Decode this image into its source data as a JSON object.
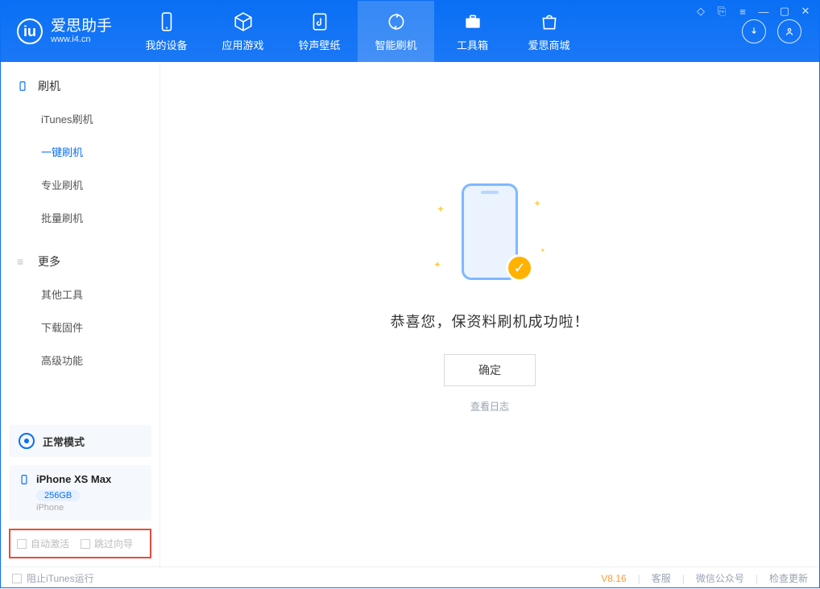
{
  "app": {
    "nameCN": "爱思助手",
    "nameEN": "www.i4.cn"
  },
  "tabs": [
    {
      "label": "我的设备"
    },
    {
      "label": "应用游戏"
    },
    {
      "label": "铃声壁纸"
    },
    {
      "label": "智能刷机"
    },
    {
      "label": "工具箱"
    },
    {
      "label": "爱思商城"
    }
  ],
  "sidebar": {
    "flashHead": "刷机",
    "flashItems": [
      "iTunes刷机",
      "一键刷机",
      "专业刷机",
      "批量刷机"
    ],
    "moreHead": "更多",
    "moreItems": [
      "其他工具",
      "下载固件",
      "高级功能"
    ]
  },
  "mode": {
    "label": "正常模式"
  },
  "device": {
    "name": "iPhone XS Max",
    "capacity": "256GB",
    "type": "iPhone"
  },
  "sideChecks": {
    "autoActivate": "自动激活",
    "skipWizard": "跳过向导"
  },
  "content": {
    "message": "恭喜您，保资料刷机成功啦！",
    "okButton": "确定",
    "viewLog": "查看日志"
  },
  "status": {
    "stopItunes": "阻止iTunes运行",
    "version": "V8.16",
    "service": "客服",
    "wechat": "微信公众号",
    "update": "检查更新"
  }
}
